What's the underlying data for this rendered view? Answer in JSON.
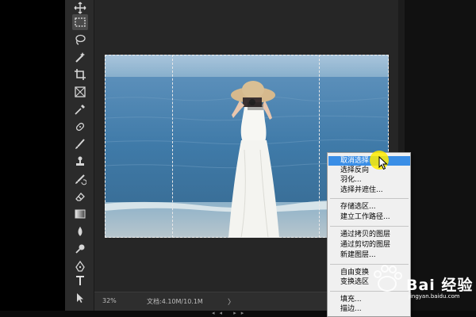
{
  "statusbar": {
    "zoom": "32%",
    "doc_info": "文档:4.10M/10.1M",
    "arrow": "〉"
  },
  "context_menu": {
    "items": [
      {
        "label": "取消选择",
        "highlighted": true
      },
      {
        "label": "选择反向"
      },
      {
        "label": "羽化..."
      },
      {
        "label": "选择并遮住..."
      },
      {
        "label": "存储选区..."
      },
      {
        "label": "建立工作路径..."
      },
      {
        "label": "通过拷贝的图层"
      },
      {
        "label": "通过剪切的图层"
      },
      {
        "label": "新建图层..."
      },
      {
        "label": "自由变换"
      },
      {
        "label": "变换选区"
      },
      {
        "label": "填充..."
      },
      {
        "label": "描边..."
      }
    ]
  },
  "tools": [
    "move-icon",
    "rectangular-marquee-icon",
    "lasso-icon",
    "quick-selection-icon",
    "crop-icon",
    "frame-icon",
    "eyedropper-icon",
    "healing-brush-icon",
    "brush-icon",
    "clone-stamp-icon",
    "history-brush-icon",
    "eraser-icon",
    "gradient-icon",
    "blur-icon",
    "dodge-icon",
    "pen-icon",
    "type-icon",
    "path-selection-icon"
  ],
  "watermark": {
    "text": "Bai 经验",
    "url": "jingyan.baidu.com"
  },
  "colors": {
    "menu_highlight": "#3a8ee6",
    "cursor_highlight": "#ffec00",
    "toolbar_bg": "#2b2b2b"
  }
}
